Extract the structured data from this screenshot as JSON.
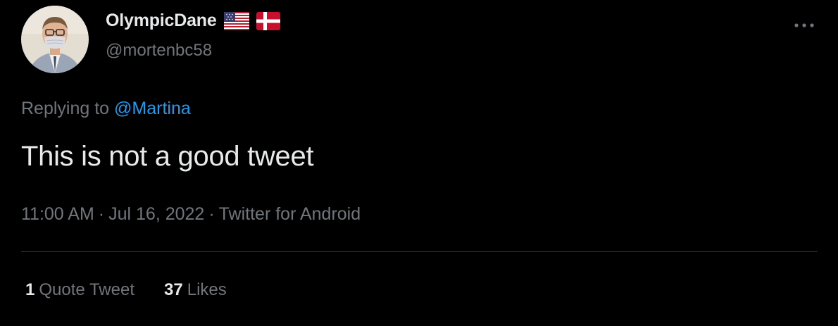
{
  "author": {
    "display_name": "OlympicDane",
    "handle": "@mortenbc58",
    "flags": [
      "us-flag-icon",
      "denmark-flag-icon"
    ]
  },
  "more_icon": "more-horizontal-icon",
  "reply_context": {
    "prefix": "Replying to",
    "mention": "@Martina"
  },
  "tweet": {
    "text": "This is not a good tweet",
    "time": "11:00 AM",
    "date": "Jul 16, 2022",
    "source": "Twitter for Android",
    "separator": "·"
  },
  "stats": {
    "quote_tweets": {
      "count": "1",
      "label": "Quote Tweet"
    },
    "likes": {
      "count": "37",
      "label": "Likes"
    }
  },
  "colors": {
    "background": "#000000",
    "primary_text": "#e7e9ea",
    "secondary_text": "#71767b",
    "link": "#1d9bf0",
    "divider": "#2f3336"
  }
}
